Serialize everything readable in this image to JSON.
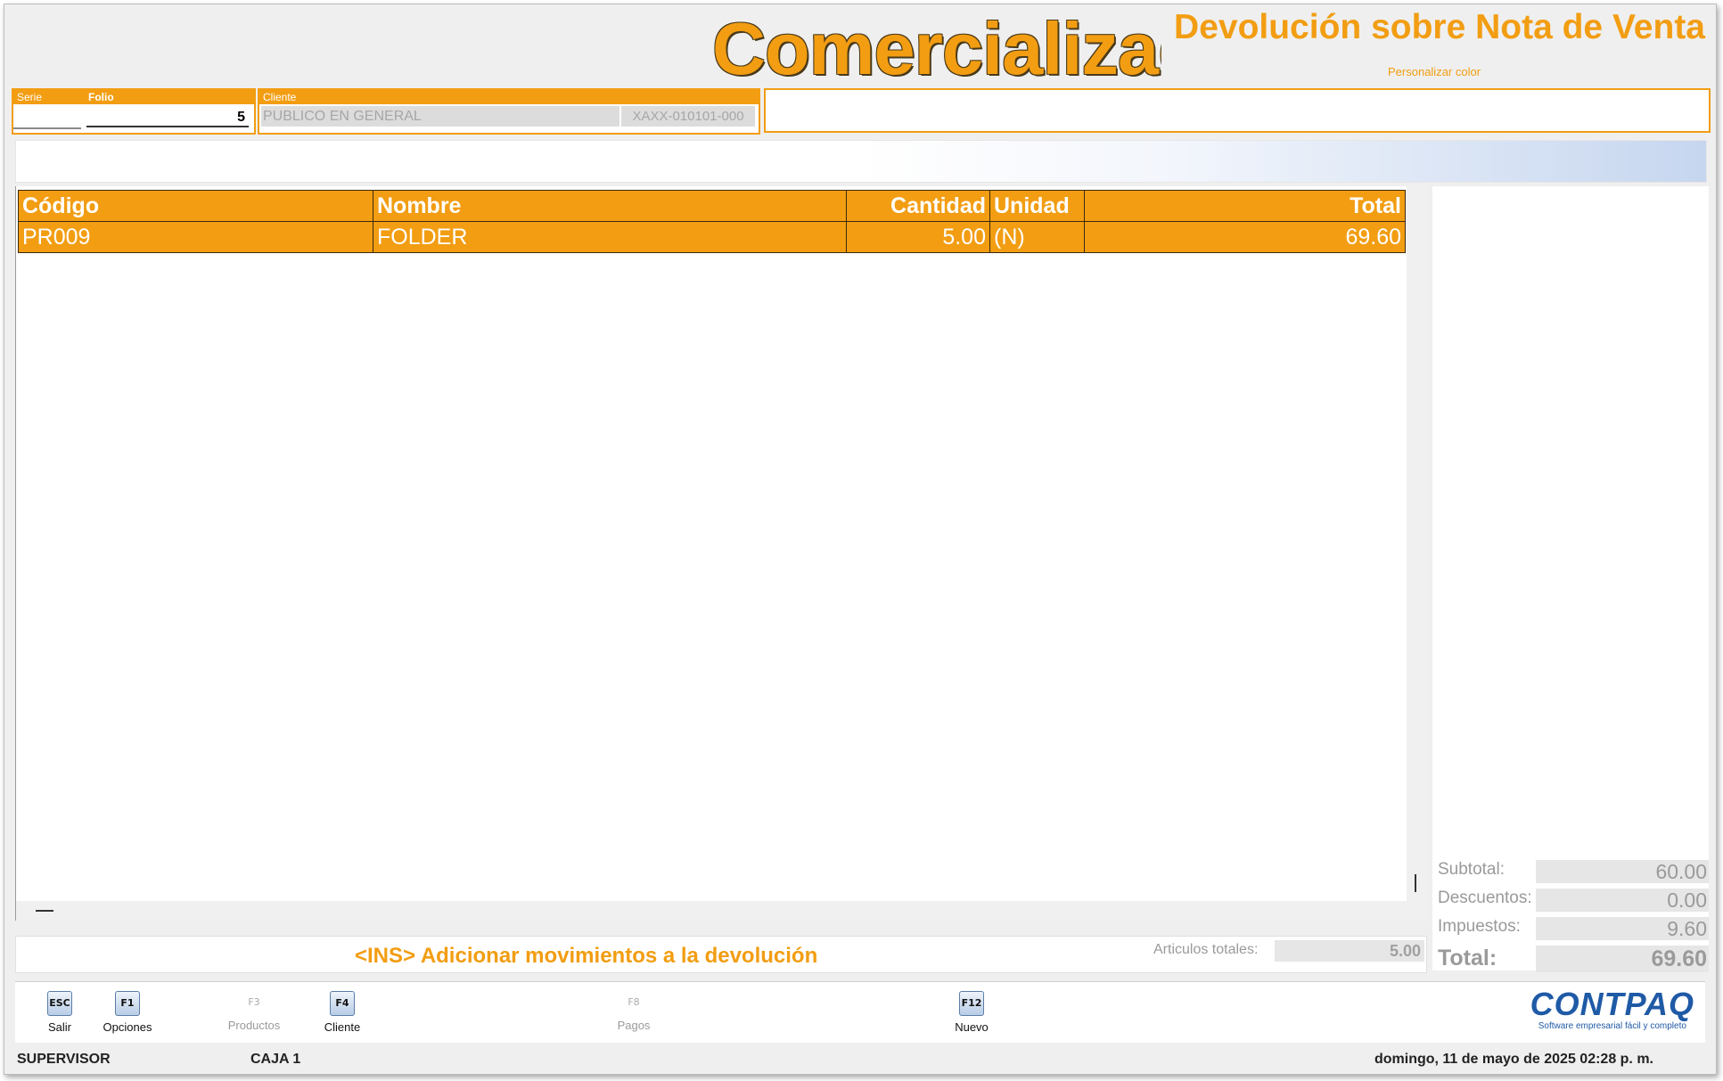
{
  "header": {
    "brand": "Comercializadora",
    "document_title": "Devolución sobre Nota de Venta",
    "custom_color_link": "Personalizar color"
  },
  "fields": {
    "serie_label": "Serie",
    "serie_value": "",
    "folio_label": "Folio",
    "folio_value": "5",
    "cliente_label": "Cliente",
    "cliente_name": "PUBLICO EN GENERAL",
    "cliente_rfc": "XAXX-010101-000"
  },
  "grid": {
    "columns": [
      "Código",
      "Nombre",
      "Cantidad",
      "Unidad",
      "Total"
    ],
    "rows": [
      {
        "codigo": "PR009",
        "nombre": "FOLDER",
        "cantidad": "5.00",
        "unidad": "(N)",
        "total": "69.60"
      }
    ]
  },
  "footer": {
    "ins_hint": "<INS> Adicionar movimientos a la devolución",
    "articulos_label": "Articulos totales:",
    "articulos_value": "5.00"
  },
  "totals": {
    "subtotal_label": "Subtotal:",
    "subtotal": "60.00",
    "descuentos_label": "Descuentos:",
    "descuentos": "0.00",
    "impuestos_label": "Impuestos:",
    "impuestos": "9.60",
    "total_label": "Total:",
    "total": "69.60"
  },
  "function_keys": [
    {
      "key": "ESC",
      "label": "Salir",
      "enabled": true
    },
    {
      "key": "F1",
      "label": "Opciones",
      "enabled": true
    },
    {
      "key": "F3",
      "label": "Productos",
      "enabled": false
    },
    {
      "key": "F4",
      "label": "Cliente",
      "enabled": true
    },
    {
      "key": "F8",
      "label": "Pagos",
      "enabled": false
    },
    {
      "key": "F12",
      "label": "Nuevo",
      "enabled": true
    }
  ],
  "logo": {
    "name": "CONTPAQ",
    "tagline": "Software empresarial fácil y completo"
  },
  "status": {
    "user": "SUPERVISOR",
    "register": "CAJA 1",
    "datetime": "domingo, 11 de mayo de 2025  02:28 p. m."
  },
  "colors": {
    "accent": "#f29d12",
    "brand_blue": "#1f5aa6"
  }
}
